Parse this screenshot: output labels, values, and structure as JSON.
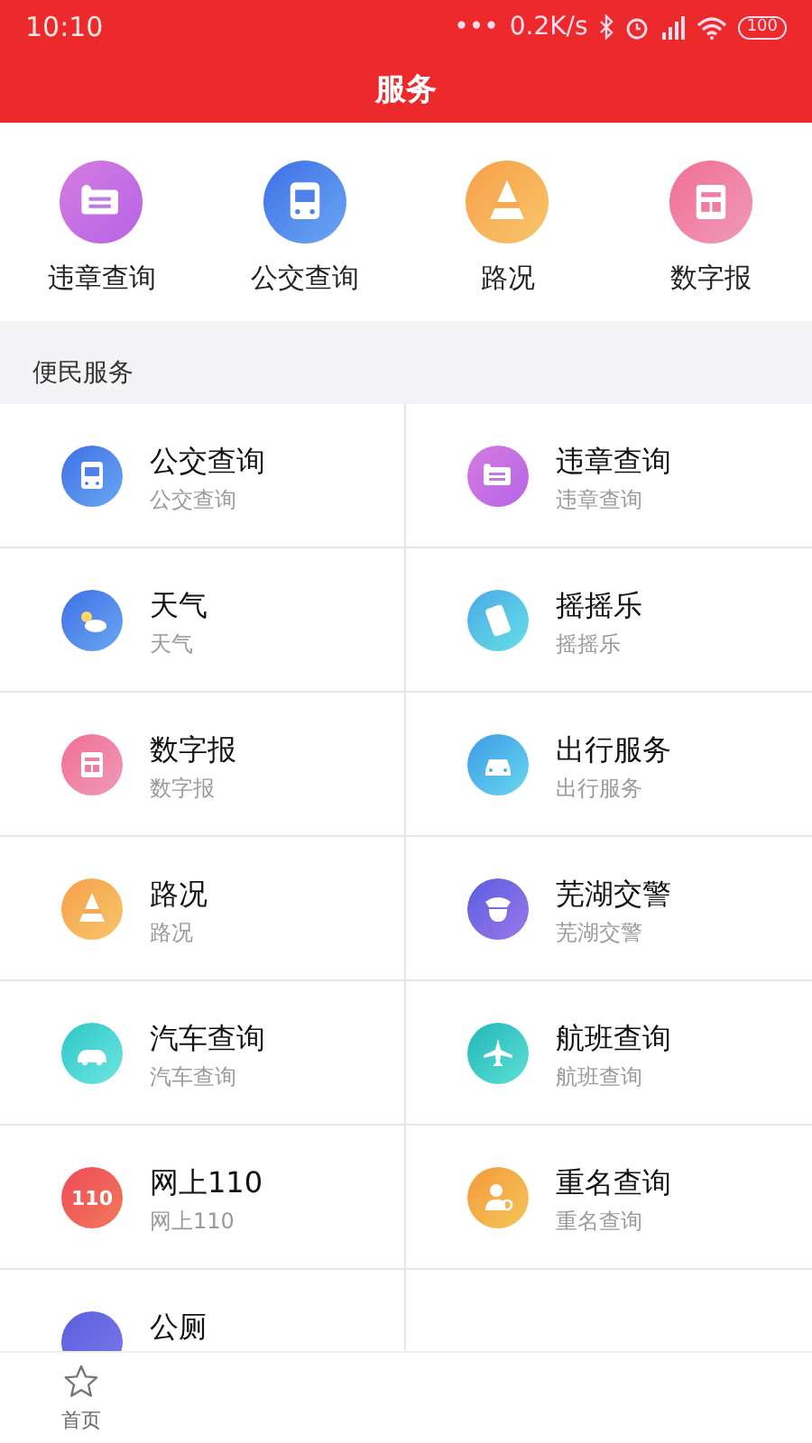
{
  "status_bar": {
    "time": "10:10",
    "dots": "•••",
    "speed": "0.2K/s",
    "battery": "100"
  },
  "header": {
    "title": "服务"
  },
  "quick_actions": [
    {
      "kind": "ticket",
      "label": "违章查询"
    },
    {
      "kind": "bus",
      "label": "公交查询"
    },
    {
      "kind": "cone",
      "label": "路况"
    },
    {
      "kind": "newspaper",
      "label": "数字报"
    }
  ],
  "section": {
    "title": "便民服务"
  },
  "services": [
    {
      "kind": "bus",
      "title": "公交查询",
      "subtitle": "公交查询"
    },
    {
      "kind": "ticket",
      "title": "违章查询",
      "subtitle": "违章查询"
    },
    {
      "kind": "weather",
      "title": "天气",
      "subtitle": "天气"
    },
    {
      "kind": "phone",
      "title": "摇摇乐",
      "subtitle": "摇摇乐"
    },
    {
      "kind": "newspaper",
      "title": "数字报",
      "subtitle": "数字报"
    },
    {
      "kind": "taxi",
      "title": "出行服务",
      "subtitle": "出行服务"
    },
    {
      "kind": "cone",
      "title": "路况",
      "subtitle": "路况"
    },
    {
      "kind": "police",
      "title": "芜湖交警",
      "subtitle": "芜湖交警"
    },
    {
      "kind": "car",
      "title": "汽车查询",
      "subtitle": "汽车查询"
    },
    {
      "kind": "plane",
      "title": "航班查询",
      "subtitle": "航班查询"
    },
    {
      "kind": "badge",
      "badge": "110",
      "title": "网上110",
      "subtitle": "网上110"
    },
    {
      "kind": "person",
      "title": "重名查询",
      "subtitle": "重名查询"
    },
    {
      "kind": "plain",
      "title": "公厕"
    }
  ],
  "tab_bar": [
    {
      "label": "首页"
    }
  ]
}
